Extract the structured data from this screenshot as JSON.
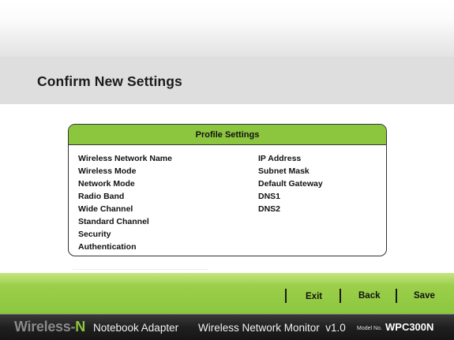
{
  "page": {
    "title": "Confirm New Settings"
  },
  "profile_panel": {
    "header": "Profile Settings",
    "left_labels": [
      "Wireless Network Name",
      "Wireless Mode",
      "Network Mode",
      "Radio Band",
      "Wide Channel",
      "Standard Channel",
      "Security",
      "Authentication"
    ],
    "right_labels": [
      "IP Address",
      "Subnet Mask",
      "Default Gateway",
      "DNS1",
      "DNS2"
    ]
  },
  "nav": {
    "exit": "Exit",
    "back": "Back",
    "save": "Save"
  },
  "brand": {
    "wireless": "Wireless",
    "dash": "-",
    "n": "N",
    "product": "Notebook Adapter",
    "app": "Wireless Network Monitor  v1.0",
    "model_label": "Model No.",
    "model": "WPC300N"
  },
  "colors": {
    "accent_green": "#8cc63f",
    "brand_bar": "#1f1f1f",
    "title_band": "#dedede"
  }
}
